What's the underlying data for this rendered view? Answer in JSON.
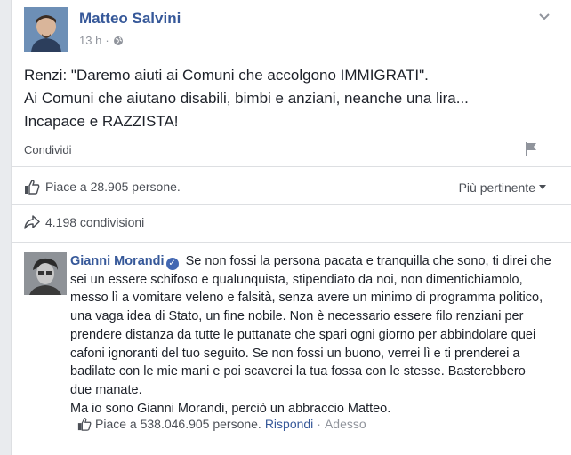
{
  "post": {
    "author": "Matteo Salvini",
    "time": "13 h",
    "separator": "·",
    "audience_icon": "globe-icon",
    "lines": [
      "Renzi: \"Daremo aiuti ai Comuni che accolgono IMMIGRATI\".",
      "Ai Comuni che aiutano disabili, bimbi e anziani, neanche una lira...",
      "Incapace e RAZZISTA!"
    ],
    "share_label": "Condividi"
  },
  "stats": {
    "likes": "Piace a 28.905 persone.",
    "sort_label": "Più pertinente",
    "shares": "4.198 condivisioni"
  },
  "comment": {
    "author": "Gianni Morandi",
    "verified_mark": "✓",
    "lines": [
      "Se non fossi la persona pacata e tranquilla che sono, ti direi che",
      "sei un essere schifoso e qualunquista, stipendiato da noi, non dimentichiamolo,",
      "messo lì a vomitare veleno e falsità, senza avere un minimo di programma politico,",
      "una vaga idea di Stato, un fine nobile. Non è necessario essere filo renziani per",
      "prendere distanza da tutte le puttanate che spari ogni giorno per abbindolare quei",
      "cafoni ignoranti del tuo seguito. Se non fossi un buono, verrei lì e ti prenderei a",
      "badilate con le mie mani e poi scaverei la tua fossa con le stesse. Basterebbero",
      "due manate.",
      "Ma io sono Gianni Morandi, perciò un abbraccio Matteo."
    ],
    "likes": "Piace a 538.046.905 persone.",
    "reply": "Rispondi",
    "dot": "·",
    "time": "Adesso"
  },
  "colors": {
    "link": "#365899",
    "text": "#1d2129",
    "secondary": "#4b4f56",
    "muted": "#90949c",
    "divider": "#dddfe2",
    "verified": "#4267b2"
  }
}
